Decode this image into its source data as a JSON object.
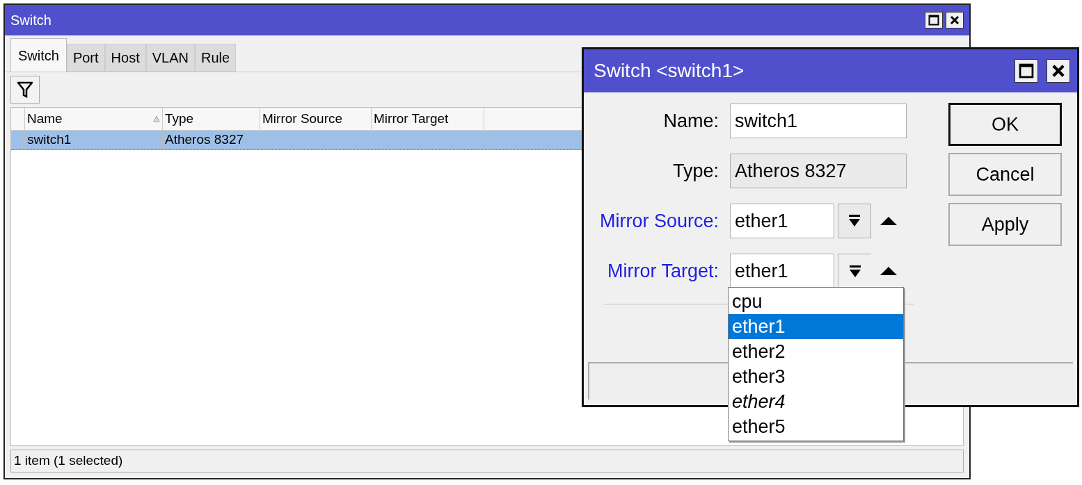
{
  "window": {
    "title": "Switch"
  },
  "tabs": [
    {
      "label": "Switch",
      "selected": true
    },
    {
      "label": "Port",
      "selected": false
    },
    {
      "label": "Host",
      "selected": false
    },
    {
      "label": "VLAN",
      "selected": false
    },
    {
      "label": "Rule",
      "selected": false
    }
  ],
  "table": {
    "columns": [
      {
        "label": "Name",
        "sorted": true
      },
      {
        "label": "Type",
        "sorted": false
      },
      {
        "label": "Mirror Source",
        "sorted": false
      },
      {
        "label": "Mirror Target",
        "sorted": false
      }
    ],
    "rows": [
      {
        "cells": [
          "switch1",
          "Atheros 8327",
          "",
          ""
        ],
        "selected": true
      }
    ]
  },
  "status_bar": "1 item (1 selected)",
  "dialog": {
    "title": "Switch <switch1>",
    "fields": [
      {
        "kind": "text",
        "label": "Name:",
        "value": "switch1"
      },
      {
        "kind": "readonly",
        "label": "Type:",
        "value": "Atheros 8327"
      },
      {
        "kind": "combo",
        "label": "Mirror Source:",
        "value": "ether1",
        "expanded": false
      },
      {
        "kind": "combo",
        "label": "Mirror Target:",
        "value": "ether1",
        "expanded": true,
        "options": [
          {
            "label": "cpu",
            "selected": false,
            "inactive": false
          },
          {
            "label": "ether1",
            "selected": true,
            "inactive": false
          },
          {
            "label": "ether2",
            "selected": false,
            "inactive": false
          },
          {
            "label": "ether3",
            "selected": false,
            "inactive": false
          },
          {
            "label": "ether4",
            "selected": false,
            "inactive": true
          },
          {
            "label": "ether5",
            "selected": false,
            "inactive": false
          }
        ]
      }
    ],
    "buttons": [
      {
        "label": "OK",
        "default": true
      },
      {
        "label": "Cancel",
        "default": false
      },
      {
        "label": "Apply",
        "default": false
      }
    ]
  }
}
